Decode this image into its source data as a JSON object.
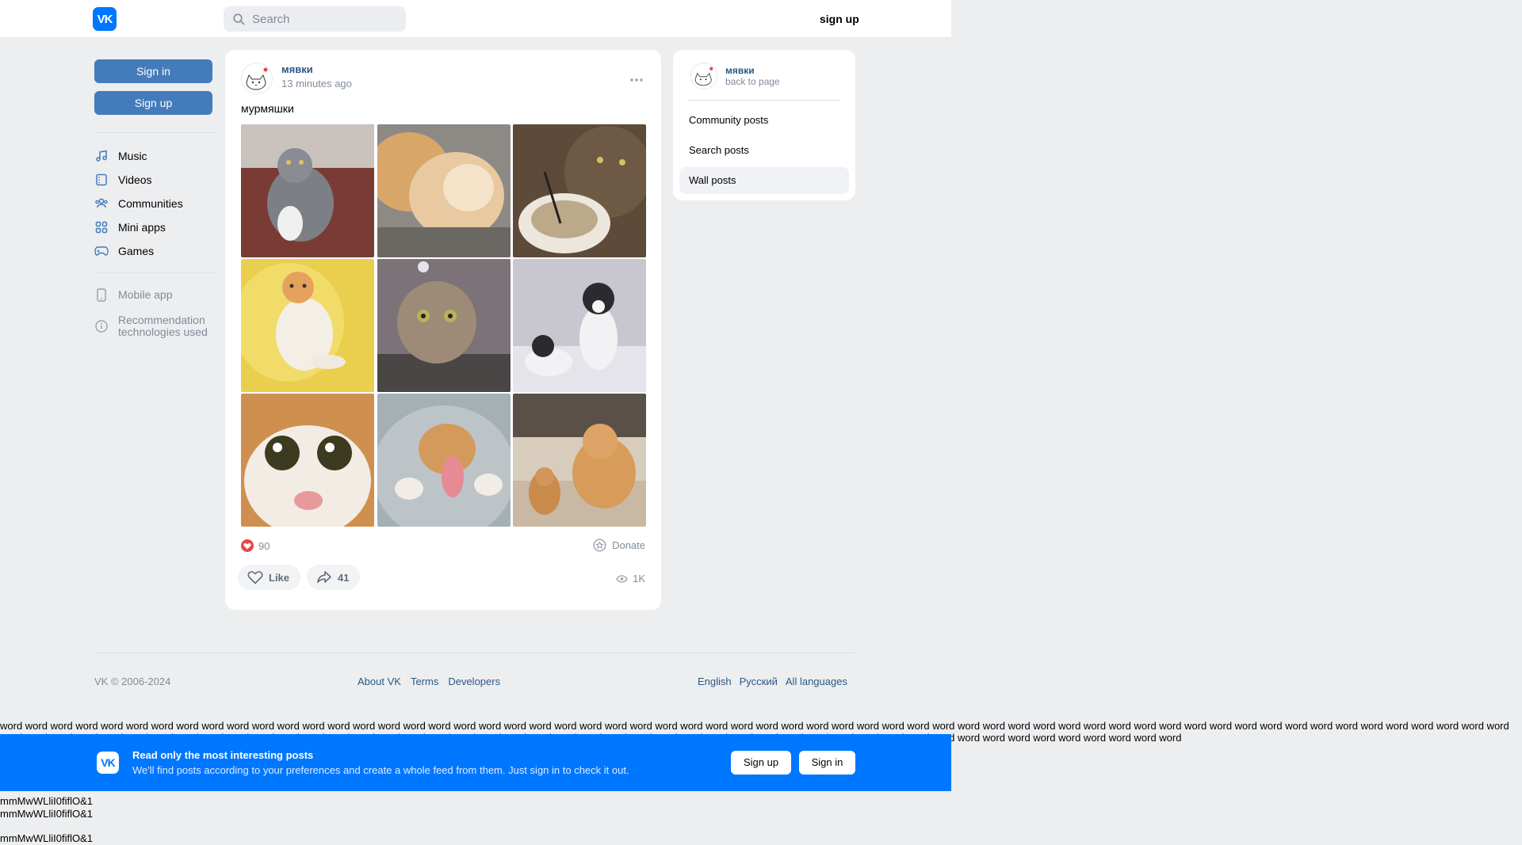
{
  "header": {
    "logo_text": "VK",
    "search_placeholder": "Search",
    "signup_label": "sign up"
  },
  "sidebar": {
    "signin_label": "Sign in",
    "signup_label": "Sign up",
    "items": [
      {
        "label": "Music",
        "icon": "music-icon"
      },
      {
        "label": "Videos",
        "icon": "video-icon"
      },
      {
        "label": "Communities",
        "icon": "communities-icon"
      },
      {
        "label": "Mini apps",
        "icon": "mini-apps-icon"
      },
      {
        "label": "Games",
        "icon": "gamepad-icon"
      }
    ],
    "mobile_app": "Mobile app",
    "recommendation_line1": "Recommendation",
    "recommendation_line2": "technologies used"
  },
  "post": {
    "author": "мявки",
    "time": "13 minutes ago",
    "text": "мурмяшки",
    "likes_count": "90",
    "donate_label": "Donate",
    "like_label": "Like",
    "shares_count": "41",
    "views_count": "1K",
    "photos": [
      "cat-photo-1",
      "cat-photo-2",
      "cat-photo-3",
      "cat-photo-4",
      "cat-photo-5",
      "cat-photo-6",
      "cat-photo-7",
      "cat-photo-8",
      "cat-photo-9"
    ]
  },
  "right_panel": {
    "name": "мявки",
    "back_label": "back to page",
    "menu": [
      "Community posts",
      "Search posts",
      "Wall posts"
    ],
    "active_index": 2
  },
  "footer": {
    "copyright": "VK © 2006-2024",
    "links": [
      "About VK",
      "Terms",
      "Developers"
    ],
    "languages": [
      "English",
      "Русский",
      "All languages"
    ]
  },
  "words_line": "word word word word word word word word word word word word word word word word word word word word word word word word word word word word word word word word word word word word word word word word word word word word word word word word word word word word word word word word word word word word word word word word word word word word word word word word word word word word word word word word word word word word word word word word word word word word word word word word word word word word word word word word word word word",
  "banner": {
    "logo_text": "VK",
    "title": "Read only the most interesting posts",
    "subtitle": "We'll find posts according to your preferences and create a whole feed from them. Just sign in to check it out.",
    "signup_label": "Sign up",
    "signin_label": "Sign in"
  },
  "font_test": [
    "mmMwWLliI0fiflO&1",
    "mmMwWLliI0fiflO&1",
    "mmMwWLliI0fiflO&1"
  ]
}
